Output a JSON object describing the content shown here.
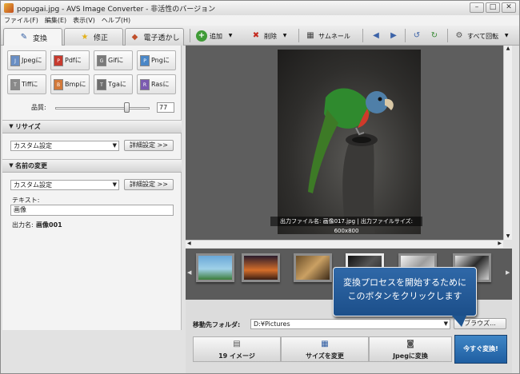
{
  "window": {
    "title": "popugai.jpg - AVS Image Converter - 非活性のバージョン",
    "min": "–",
    "max": "□",
    "close": "✕"
  },
  "menu": [
    "ファイル(F)",
    "編集(E)",
    "表示(V)",
    "ヘルプ(H)"
  ],
  "tabs": [
    {
      "label": "変換"
    },
    {
      "label": "修正"
    },
    {
      "label": "電子透かし"
    }
  ],
  "toolbar": {
    "add": "追加",
    "delete": "削除",
    "thumbnail": "サムネール",
    "rotate_all": "すべて回転"
  },
  "formats": [
    "Jpegに",
    "Pdfに",
    "Gifに",
    "Pngに",
    "Tiffに",
    "Bmpに",
    "Tgaに",
    "Rasに"
  ],
  "quality": {
    "label": "品質:",
    "value": "77",
    "level": 0.77
  },
  "resize": {
    "title": "リサイズ",
    "preset": "カスタム設定",
    "advanced": "詳細設定 >>"
  },
  "rename": {
    "title": "名前の変更",
    "preset": "カスタム設定",
    "advanced": "詳細設定 >>",
    "text_label": "テキスト:",
    "text_value": "画像",
    "output_label": "出力名:",
    "output_value": "画像001"
  },
  "preview": {
    "caption": "出力ファイル名: 画像017.jpg | 出力ファイルサイズ: 600x800"
  },
  "destination": {
    "label": "移動先フォルダ:",
    "path": "D:¥Pictures",
    "browse": "ブラウズ..."
  },
  "steps": [
    {
      "label": "19 イメージ"
    },
    {
      "label": "サイズを変更"
    },
    {
      "label": "Jpegに変換"
    }
  ],
  "convert_button": "今すぐ変換!",
  "tooltip": "変換プロセスを開始するために\nこのボタンをクリックします"
}
